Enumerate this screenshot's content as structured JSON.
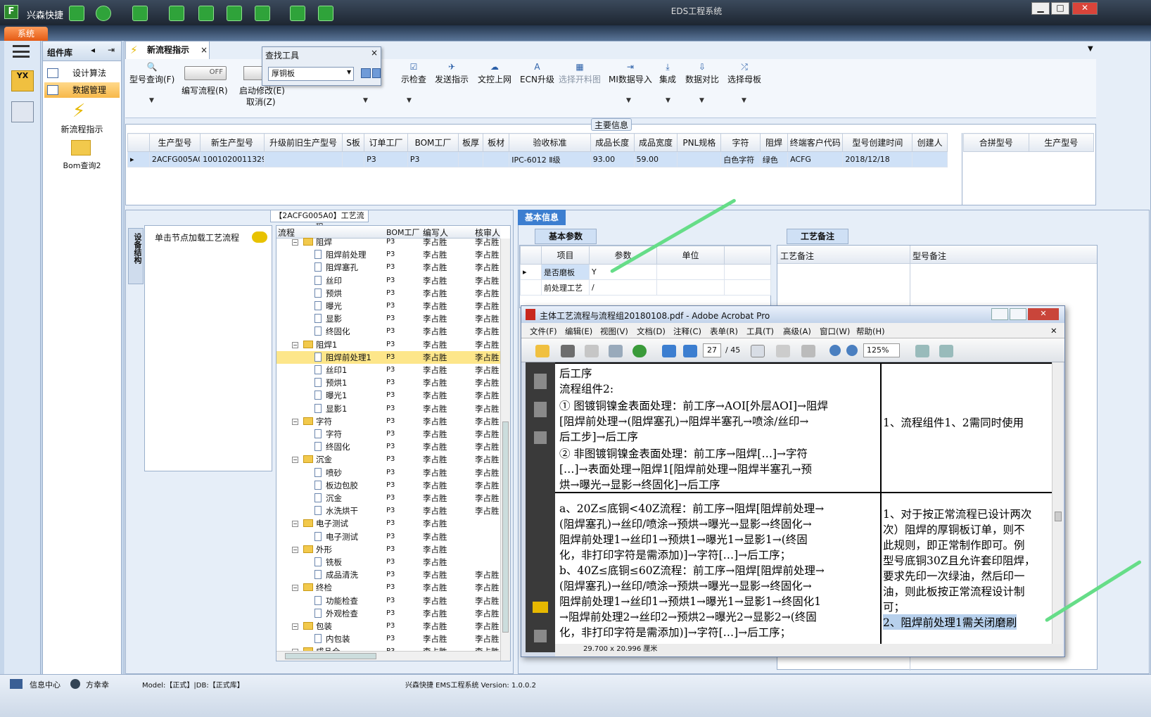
{
  "app": {
    "short_name": "兴森快捷",
    "window_title": "EDS工程系统",
    "sys_tab": "系统",
    "min": "▁",
    "max": "□",
    "close": "✕"
  },
  "colors": {
    "accent": "#3c7ed0",
    "selection": "#fde68a",
    "grid_sel": "#cfe1f7",
    "arrow": "#66dd88"
  },
  "left_panel": {
    "title": "组件库",
    "items": [
      "设计算法",
      "数据管理"
    ],
    "launch": [
      {
        "label": "新流程指示",
        "icon": "lightning-icon"
      },
      {
        "label": "Bom查询2",
        "icon": "folder-icon"
      }
    ]
  },
  "doc_tab": {
    "label": "新流程指示",
    "close": "×"
  },
  "ribbon": {
    "buttons": [
      {
        "label": "型号查询(F)",
        "glyph": "🔍"
      },
      {
        "label": "编写流程(R)",
        "glyph": ""
      },
      {
        "label": "启动修改(E)",
        "glyph": ""
      },
      {
        "label": "取消(Z)",
        "glyph": ""
      },
      {
        "label": "示检查",
        "glyph": "☑"
      },
      {
        "label": "发送指示",
        "glyph": "✈"
      },
      {
        "label": "文控上网",
        "glyph": "☁"
      },
      {
        "label": "ECN升级",
        "glyph": "A"
      },
      {
        "label": "选择开料图",
        "glyph": "▦"
      },
      {
        "label": "MI数据导入",
        "glyph": "⇥"
      },
      {
        "label": "集成",
        "glyph": "⤓"
      },
      {
        "label": "数据对比",
        "glyph": "⇩"
      },
      {
        "label": "选择母板",
        "glyph": "⤮"
      }
    ],
    "toggle": "OFF"
  },
  "finder": {
    "title": "查找工具",
    "value": "厚铜板",
    "close": "×"
  },
  "main_info": {
    "title": "主要信息",
    "columns": [
      "生产型号",
      "新生产型号",
      "升级前旧生产型号",
      "S板",
      "订单工厂",
      "BOM工厂",
      "板厚",
      "板材",
      "验收标准",
      "成品长度",
      "成品宽度",
      "PNL规格",
      "字符",
      "阻焊",
      "终端客户代码",
      "型号创建时间",
      "创建人"
    ],
    "row": [
      "2ACFG005A0",
      "10010200113292",
      "",
      "",
      "P3",
      "P3",
      "",
      "",
      "IPC-6012 Ⅱ级",
      "93.00",
      "59.00",
      "",
      "白色字符",
      "绿色",
      "ACFG",
      "2018/12/18",
      ""
    ],
    "right_columns": [
      "合拼型号",
      "生产型号"
    ]
  },
  "flow": {
    "title": "【2ACFG005A0】工艺流程",
    "side_tab": "设备结构",
    "hint": "单击节点加载工艺流程",
    "columns": [
      "流程",
      "BOM工厂",
      "编写人",
      "核审人"
    ],
    "rows": [
      {
        "n": "阻焊",
        "l": 1,
        "f": true,
        "b": "P3",
        "w": "李占胜",
        "r": "李占胜"
      },
      {
        "n": "阻焊前处理",
        "l": 2,
        "b": "P3",
        "w": "李占胜",
        "r": "李占胜"
      },
      {
        "n": "阻焊塞孔",
        "l": 2,
        "b": "P3",
        "w": "李占胜",
        "r": "李占胜"
      },
      {
        "n": "丝印",
        "l": 2,
        "b": "P3",
        "w": "李占胜",
        "r": "李占胜"
      },
      {
        "n": "预烘",
        "l": 2,
        "b": "P3",
        "w": "李占胜",
        "r": "李占胜"
      },
      {
        "n": "曝光",
        "l": 2,
        "b": "P3",
        "w": "李占胜",
        "r": "李占胜"
      },
      {
        "n": "显影",
        "l": 2,
        "b": "P3",
        "w": "李占胜",
        "r": "李占胜"
      },
      {
        "n": "终固化",
        "l": 2,
        "b": "P3",
        "w": "李占胜",
        "r": "李占胜"
      },
      {
        "n": "阻焊1",
        "l": 1,
        "f": true,
        "b": "P3",
        "w": "李占胜",
        "r": "李占胜"
      },
      {
        "n": "阻焊前处理1",
        "l": 2,
        "b": "P3",
        "w": "李占胜",
        "r": "李占胜",
        "sel": true
      },
      {
        "n": "丝印1",
        "l": 2,
        "b": "P3",
        "w": "李占胜",
        "r": "李占胜"
      },
      {
        "n": "预烘1",
        "l": 2,
        "b": "P3",
        "w": "李占胜",
        "r": "李占胜"
      },
      {
        "n": "曝光1",
        "l": 2,
        "b": "P3",
        "w": "李占胜",
        "r": "李占胜"
      },
      {
        "n": "显影1",
        "l": 2,
        "b": "P3",
        "w": "李占胜",
        "r": "李占胜"
      },
      {
        "n": "字符",
        "l": 1,
        "f": true,
        "b": "P3",
        "w": "李占胜",
        "r": "李占胜"
      },
      {
        "n": "字符",
        "l": 2,
        "b": "P3",
        "w": "李占胜",
        "r": "李占胜"
      },
      {
        "n": "终固化",
        "l": 2,
        "b": "P3",
        "w": "李占胜",
        "r": "李占胜"
      },
      {
        "n": "沉金",
        "l": 1,
        "f": true,
        "b": "P3",
        "w": "李占胜",
        "r": "李占胜"
      },
      {
        "n": "喷砂",
        "l": 2,
        "b": "P3",
        "w": "李占胜",
        "r": "李占胜"
      },
      {
        "n": "板边包胶",
        "l": 2,
        "b": "P3",
        "w": "李占胜",
        "r": "李占胜"
      },
      {
        "n": "沉金",
        "l": 2,
        "b": "P3",
        "w": "李占胜",
        "r": "李占胜"
      },
      {
        "n": "水洗烘干",
        "l": 2,
        "b": "P3",
        "w": "李占胜",
        "r": "李占胜"
      },
      {
        "n": "电子测试",
        "l": 1,
        "f": true,
        "b": "P3",
        "w": "李占胜",
        "r": ""
      },
      {
        "n": "电子测试",
        "l": 2,
        "b": "P3",
        "w": "李占胜",
        "r": ""
      },
      {
        "n": "外形",
        "l": 1,
        "f": true,
        "b": "P3",
        "w": "李占胜",
        "r": ""
      },
      {
        "n": "铣板",
        "l": 2,
        "b": "P3",
        "w": "李占胜",
        "r": ""
      },
      {
        "n": "成品清洗",
        "l": 2,
        "b": "P3",
        "w": "李占胜",
        "r": "李占胜"
      },
      {
        "n": "终检",
        "l": 1,
        "f": true,
        "b": "P3",
        "w": "李占胜",
        "r": "李占胜"
      },
      {
        "n": "功能检查",
        "l": 2,
        "b": "P3",
        "w": "李占胜",
        "r": "李占胜"
      },
      {
        "n": "外观检查",
        "l": 2,
        "b": "P3",
        "w": "李占胜",
        "r": "李占胜"
      },
      {
        "n": "包装",
        "l": 1,
        "f": true,
        "b": "P3",
        "w": "李占胜",
        "r": "李占胜"
      },
      {
        "n": "内包装",
        "l": 2,
        "b": "P3",
        "w": "李占胜",
        "r": "李占胜"
      },
      {
        "n": "成品仓",
        "l": 1,
        "f": true,
        "b": "P3",
        "w": "李占胜",
        "r": "李占胜"
      }
    ]
  },
  "basic": {
    "tab": "基本信息",
    "param_tab": "基本参数",
    "remark_tab": "工艺备注",
    "param_columns": [
      "项目",
      "参数",
      "单位"
    ],
    "params": [
      [
        "是否磨板",
        "Y",
        ""
      ],
      [
        "前处理工艺",
        "/",
        ""
      ]
    ],
    "remark_columns": [
      "工艺备注",
      "型号备注"
    ]
  },
  "acrobat": {
    "title": "主体工艺流程与流程组20180108.pdf - Adobe Acrobat Pro",
    "menus": [
      "文件(F)",
      "编辑(E)",
      "视图(V)",
      "文档(D)",
      "注释(C)",
      "表单(R)",
      "工具(T)",
      "高级(A)",
      "窗口(W)",
      "帮助(H)"
    ],
    "page": "27",
    "pages": "/ 45",
    "zoom": "125%",
    "page_size": "29.700 x 20.996 厘米",
    "left_lines": [
      "后工序",
      "流程组件2:",
      "① 图镀铜镍金表面处理：前工序→AOI[外层AOI]→阻焊",
      "[阻焊前处理→(阻焊塞孔)→阻焊半塞孔→喷涂/丝印→",
      "后工步]→后工序",
      "② 非图镀铜镍金表面处理：前工序→阻焊[…]→字符",
      "[…]→表面处理→阻焊1[阻焊前处理→阻焊半塞孔→预",
      "烘→曝光→显影→终固化]→后工序",
      "a、20Z≤底铜<40Z流程：前工序→阻焊[阻焊前处理→",
      "(阻焊塞孔)→丝印/喷涂→预烘→曝光→显影→终固化→",
      "阻焊前处理1→丝印1→预烘1→曝光1→显影1→(终固",
      "化，非打印字符是需添加)]→字符[…]→后工序；",
      "b、40Z≤底铜≤60Z流程：前工序→阻焊[阻焊前处理→",
      "(阻焊塞孔)→丝印/喷涂→预烘→曝光→显影→终固化→",
      "阻焊前处理1→丝印1→预烘1→曝光1→显影1→终固化1",
      "→阻焊前处理2→丝印2→预烘2→曝光2→显影2→(终固",
      "化，非打印字符是需添加)]→字符[…]→后工序；"
    ],
    "right_lines": [
      "1、流程组件1、2需同时使用",
      "1、对于按正常流程已设计两次",
      "次）阻焊的厚铜板订单，则不",
      "此规则，即正常制作即可。例",
      "型号底铜30Z且允许套印阻焊，",
      "要求先印一次绿油，然后印一",
      "油，则此板按正常流程设计制",
      "可；",
      "2、阻焊前处理1需关闭磨刷"
    ]
  },
  "status": {
    "info_center": "信息中心",
    "user": "方幸幸",
    "model": "Model:【正式】|DB:【正式库】",
    "product": "兴森快捷 EMS工程系统 Version: 1.0.0.2"
  }
}
